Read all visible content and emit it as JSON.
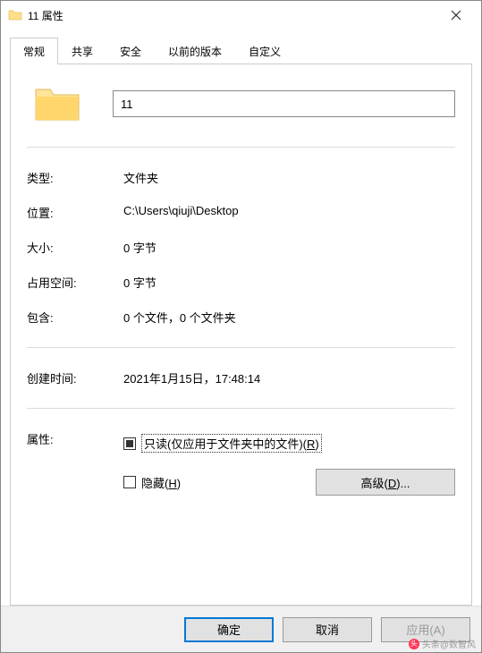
{
  "window": {
    "title": "11 属性"
  },
  "tabs": {
    "general": "常规",
    "share": "共享",
    "security": "安全",
    "previous": "以前的版本",
    "custom": "自定义"
  },
  "folder": {
    "name": "11"
  },
  "props": {
    "type_label": "类型:",
    "type_value": "文件夹",
    "location_label": "位置:",
    "location_value": "C:\\Users\\qiuji\\Desktop",
    "size_label": "大小:",
    "size_value": "0 字节",
    "sizeondisk_label": "占用空间:",
    "sizeondisk_value": "0 字节",
    "contains_label": "包含:",
    "contains_value": "0 个文件，0 个文件夹",
    "created_label": "创建时间:",
    "created_value": "2021年1月15日，17:48:14",
    "attributes_label": "属性:"
  },
  "attributes": {
    "readonly_label": "只读(仅应用于文件夹中的文件)(",
    "readonly_key": "R",
    "readonly_close": ")",
    "hidden_label": "隐藏(",
    "hidden_key": "H",
    "hidden_close": ")",
    "advanced_label": "高级(",
    "advanced_key": "D",
    "advanced_close": ")..."
  },
  "buttons": {
    "ok": "确定",
    "cancel": "取消",
    "apply": "应用(A)"
  },
  "watermark": {
    "text": "头条@数智风"
  }
}
